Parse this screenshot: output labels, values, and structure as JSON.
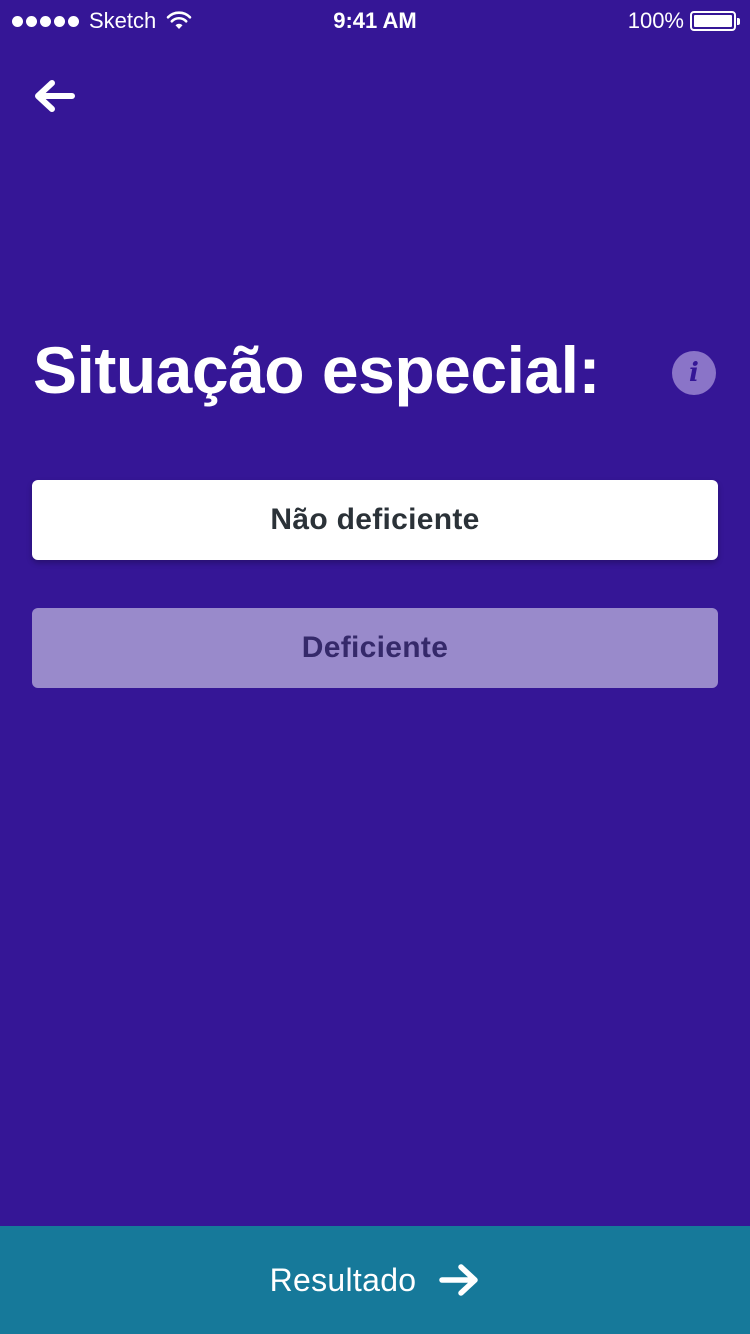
{
  "status_bar": {
    "carrier": "Sketch",
    "time": "9:41 AM",
    "battery_percent": "100%"
  },
  "navigation": {
    "back_icon": "arrow-left-icon"
  },
  "page": {
    "title": "Situação especial:",
    "info_icon": "info-icon",
    "info_glyph": "i"
  },
  "options": [
    {
      "label": "Não deficiente",
      "selected": true
    },
    {
      "label": "Deficiente",
      "selected": false
    }
  ],
  "footer": {
    "action_label": "Resultado",
    "action_icon": "arrow-right-icon"
  },
  "colors": {
    "background": "#351696",
    "option_selected_bg": "#ffffff",
    "option_unselected_bg": "#998acb",
    "footer_bg": "#16799a",
    "info_bg": "#8a74c8"
  }
}
